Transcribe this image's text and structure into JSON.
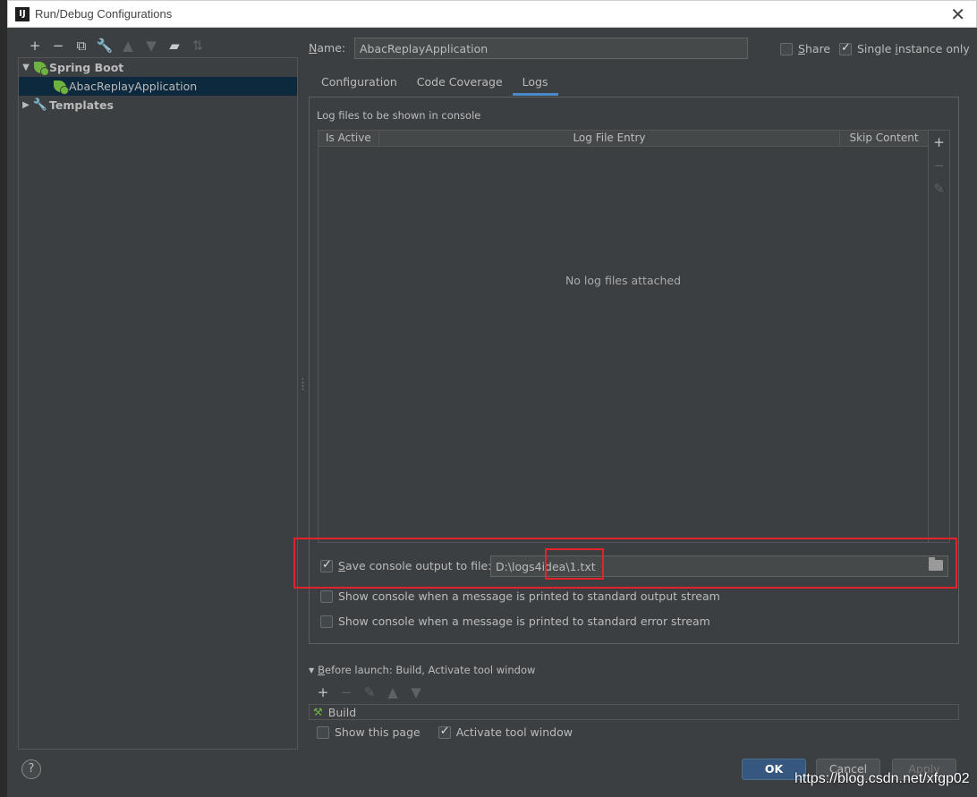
{
  "window": {
    "title": "Run/Debug Configurations",
    "app_icon_text": "IJ",
    "close_glyph": "✕"
  },
  "toolbar": {
    "items": [
      {
        "name": "add-icon",
        "glyph": "+",
        "enabled": true
      },
      {
        "name": "remove-icon",
        "glyph": "−",
        "enabled": true
      },
      {
        "name": "copy-icon",
        "glyph": "⧉",
        "enabled": true
      },
      {
        "name": "wrench-icon",
        "glyph": "🔧",
        "enabled": true
      },
      {
        "name": "move-up-icon",
        "glyph": "▲",
        "enabled": false
      },
      {
        "name": "move-down-icon",
        "glyph": "▼",
        "enabled": false
      },
      {
        "name": "new-folder-icon",
        "glyph": "▰",
        "enabled": true
      },
      {
        "name": "sort-icon",
        "glyph": "⇅",
        "enabled": false
      }
    ]
  },
  "tree": {
    "spring_boot": "Spring Boot",
    "app": "AbacReplayApplication",
    "templates": "Templates"
  },
  "config": {
    "name_label_prefix": "",
    "name_label_mnemonic": "N",
    "name_label_rest": "ame:",
    "name_value": "AbacReplayApplication",
    "share_mnemonic": "S",
    "share_rest": "hare",
    "share_checked": false,
    "single_prefix": "Single ",
    "single_mnemonic": "i",
    "single_rest": "nstance only",
    "single_checked": true
  },
  "tabs": [
    {
      "label": "Configuration",
      "active": false
    },
    {
      "label": "Code Coverage",
      "active": false
    },
    {
      "label": "Logs",
      "active": true
    }
  ],
  "logs": {
    "caption": "Log files to be shown in console",
    "col_active": "Is Active",
    "col_entry": "Log File Entry",
    "col_skip": "Skip Content",
    "empty": "No log files attached",
    "side_add": "+",
    "side_remove": "−",
    "side_edit": "✎",
    "save_mnemonic": "S",
    "save_rest": "ave console output to file:",
    "save_checked": true,
    "save_path": "D:\\logs4idea\\1.txt",
    "show_stdout": "Show console when a message is printed to standard output stream",
    "show_stderr": "Show console when a message is printed to standard error stream"
  },
  "before_launch": {
    "title_mnemonic": "B",
    "title_rest": "efore launch: Build, Activate tool window",
    "tools": [
      {
        "name": "add-icon",
        "glyph": "+",
        "enabled": true
      },
      {
        "name": "remove-icon",
        "glyph": "−",
        "enabled": false
      },
      {
        "name": "edit-icon",
        "glyph": "✎",
        "enabled": false
      },
      {
        "name": "move-up-icon",
        "glyph": "▲",
        "enabled": false
      },
      {
        "name": "move-down-icon",
        "glyph": "▼",
        "enabled": false
      }
    ],
    "build_item": "Build",
    "show_page": "Show this page",
    "show_page_checked": false,
    "activate": "Activate tool window",
    "activate_checked": true
  },
  "buttons": {
    "help": "?",
    "ok": "OK",
    "cancel": "Cancel",
    "apply": "Apply"
  },
  "watermark": "https://blog.csdn.net/xfgp02",
  "colors": {
    "accent": "#4a88c7",
    "highlight_box": "#e0242a",
    "ok_button": "#365880",
    "spring": "#6db33f"
  }
}
